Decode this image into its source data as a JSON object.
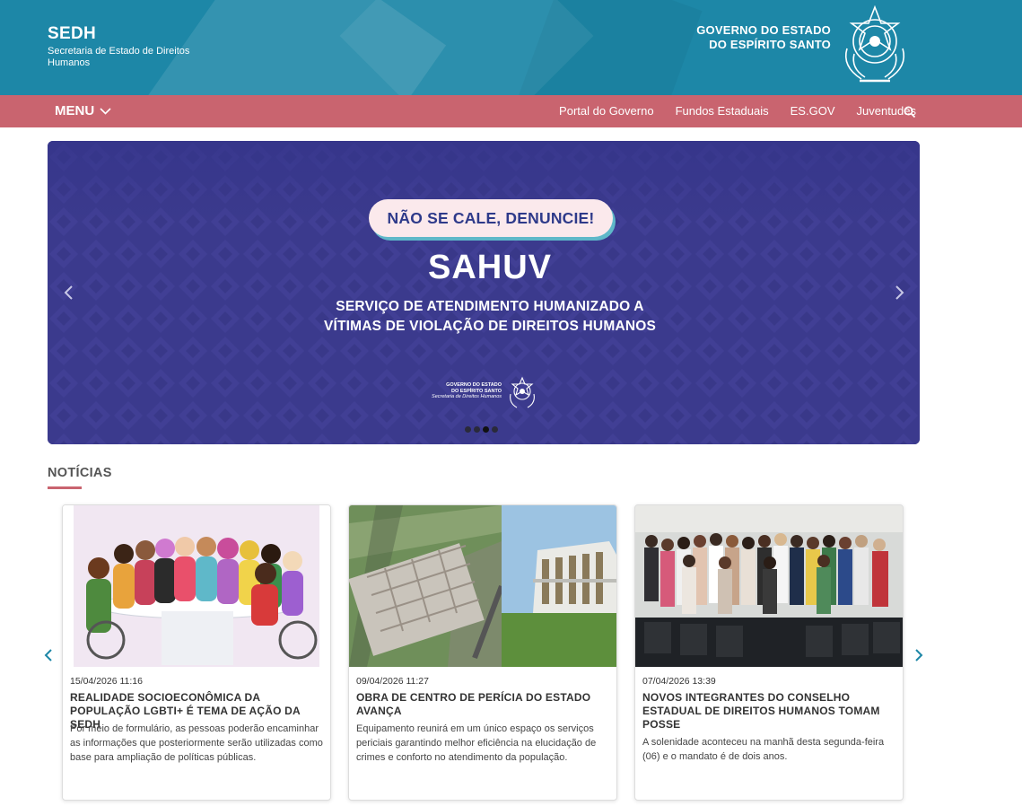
{
  "header": {
    "site_title": "SEDH",
    "site_subtitle": "Secretaria de Estado de Direitos Humanos",
    "gov_line1": "GOVERNO DO ESTADO",
    "gov_line2": "DO ESPÍRITO SANTO"
  },
  "nav": {
    "menu_label": "MENU",
    "links": [
      "Portal do Governo",
      "Fundos Estaduais",
      "ES.GOV",
      "Juventudes"
    ]
  },
  "banner": {
    "pill_text": "NÃO SE CALE, DENUNCIE!",
    "title": "SAHUV",
    "line1": "SERVIÇO DE ATENDIMENTO HUMANIZADO A",
    "line2": "VÍTIMAS DE VIOLAÇÃO DE DIREITOS HUMANOS",
    "logo_line1": "GOVERNO DO ESTADO",
    "logo_line2": "DO ESPÍRITO SANTO",
    "logo_line3": "Secretaria de Direitos Humanos",
    "slide_count": 4,
    "active_slide": 3
  },
  "news": {
    "section_title": "NOTÍCIAS",
    "items": [
      {
        "date": "15/04/2026 11:16",
        "title": "REALIDADE SOCIOECONÔMICA DA POPULAÇÃO LGBTI+ É TEMA DE AÇÃO DA SEDH",
        "text": "Por meio de formulário, as pessoas poderão encaminhar as informações que posteriormente serão utilizadas como base para ampliação de políticas públicas."
      },
      {
        "date": "09/04/2026 11:27",
        "title": "OBRA DE CENTRO DE PERÍCIA DO ESTADO AVANÇA",
        "text": "Equipamento reunirá em um único espaço os serviços periciais garantindo melhor eficiência na elucidação de crimes e conforto no atendimento da população."
      },
      {
        "date": "07/04/2026 13:39",
        "title": "NOVOS INTEGRANTES DO CONSELHO ESTADUAL DE DIREITOS HUMANOS TOMAM POSSE",
        "text": "A solenidade aconteceu na manhã desta segunda-feira (06) e o mandato é de dois anos."
      }
    ]
  },
  "colors": {
    "header_bg": "#1d87a7",
    "nav_bg": "#c9646f",
    "banner_bg": "#3a3a8c",
    "accent_cyan": "#5fb8c9"
  },
  "icons": [
    "chevron-down-icon",
    "search-icon",
    "chevron-left-icon",
    "chevron-right-icon",
    "coat-of-arms-icon"
  ]
}
